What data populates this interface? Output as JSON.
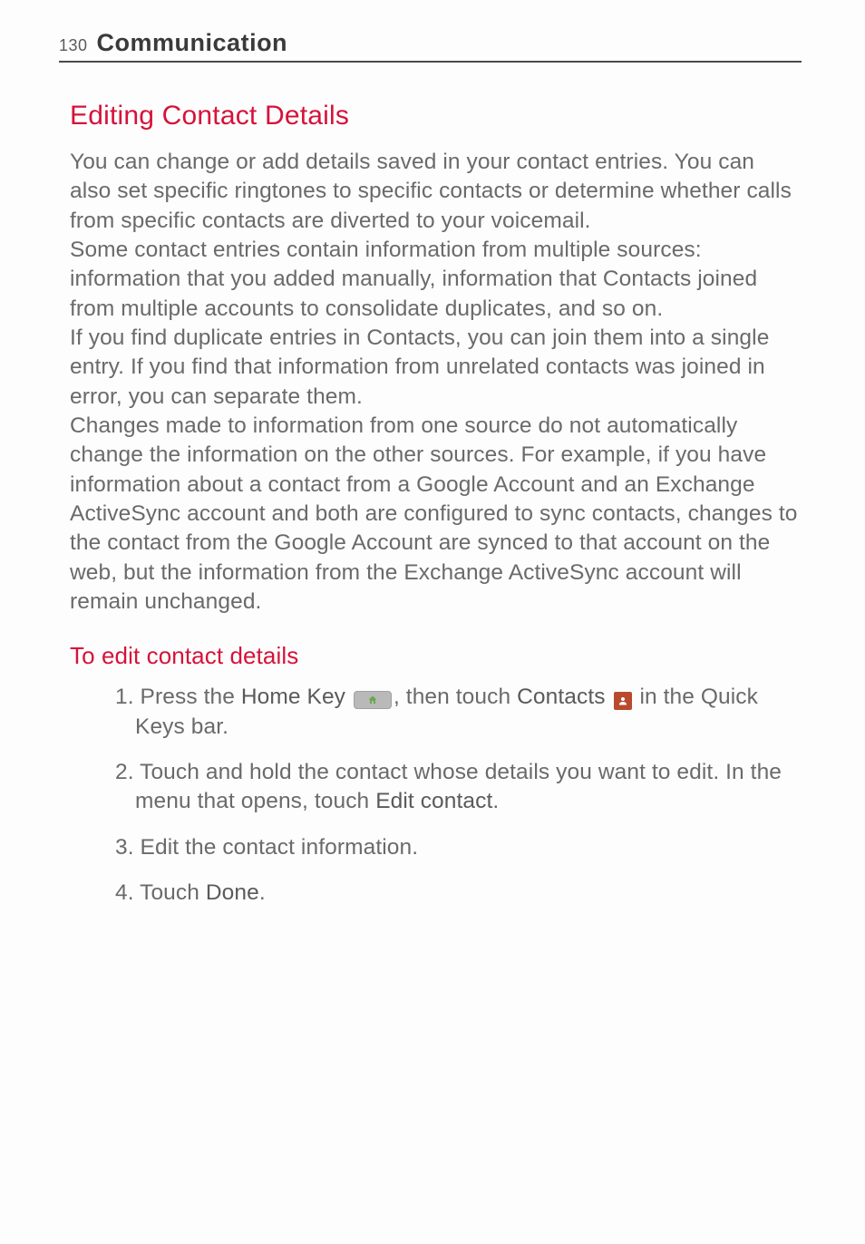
{
  "header": {
    "page_number": "130",
    "chapter_title": "Communication"
  },
  "section": {
    "title": "Editing Contact Details",
    "paragraphs": [
      "You can change or add details saved in your contact entries. You can also set specific ringtones to specific contacts or determine whether calls from specific contacts are diverted to your voicemail.",
      "Some contact entries contain information from multiple sources: information that you added manually, information that Contacts joined from multiple accounts to consolidate duplicates, and so on.",
      "If you find duplicate entries in Contacts, you can join them into a single entry. If you find that information from unrelated contacts was joined in error, you can separate them.",
      "Changes made to information from one source do not automatically change the information on the other sources. For example, if you have information about a contact from a Google Account and an Exchange ActiveSync account and both are configured to sync contacts, changes to the contact from the Google Account are synced to that account on the web, but the information from the Exchange ActiveSync account will remain unchanged."
    ],
    "subsection_title": "To edit contact details",
    "steps": {
      "s1": {
        "num": "1.",
        "pre": " Press the ",
        "k1": "Home Key",
        "mid": ", then touch ",
        "k2": "Contacts",
        "post": " in the Quick Keys bar."
      },
      "s2": {
        "num": "2.",
        "line1": " Touch and hold the contact whose details you want to edit. In the menu that opens, touch ",
        "k1": "Edit contact",
        "post": "."
      },
      "s3": {
        "num": "3.",
        "text": "  Edit the contact information."
      },
      "s4": {
        "num": "4.",
        "pre": " Touch ",
        "k1": "Done",
        "post": "."
      }
    }
  },
  "icons": {
    "home": "home-key-icon",
    "contacts": "contacts-icon"
  }
}
